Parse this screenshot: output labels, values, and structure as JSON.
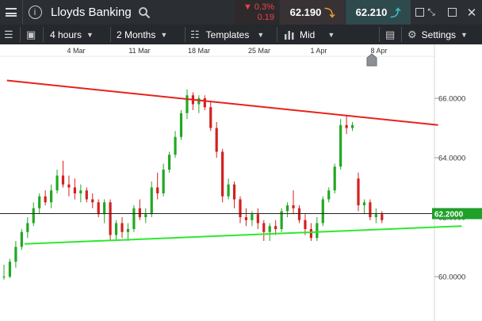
{
  "header": {
    "instrument_name": "Lloyds Banking",
    "change_percent": "0.3%",
    "change_abs": "0.19",
    "sell_price": "62.190",
    "buy_price": "62.210",
    "icons": [
      "menu-icon",
      "info-icon",
      "search-icon",
      "down-arrow-icon",
      "up-arrow-icon",
      "checkbox-icon",
      "shrink-icon",
      "popout-icon",
      "close-icon"
    ]
  },
  "toolbar": {
    "interval": "4 hours",
    "range": "2 Months",
    "templates_label": "Templates",
    "price_type": "Mid",
    "settings_label": "Settings",
    "icons": [
      "list-icon",
      "layout-icon",
      "templates-icon",
      "bar-chart-icon",
      "panel-icon",
      "gear-icon"
    ]
  },
  "colors": {
    "resistance_line": "#e8211c",
    "support_line": "#2ee82e",
    "up_candle": "#22a822",
    "down_candle": "#d42020",
    "price_label_bg": "#1fa02a"
  },
  "chart_data": {
    "type": "candlestick",
    "x_labels": [
      "4 Mar",
      "11 Mar",
      "18 Mar",
      "25 Mar",
      "1 Apr",
      "8 Apr"
    ],
    "y_ticks": [
      "66.0000",
      "64.0000",
      "62.0000",
      "60.0000"
    ],
    "y_range": [
      59.3,
      67.3
    ],
    "current_price_label": "62.2000",
    "current_price": 62.2,
    "trendlines": [
      {
        "name": "resistance",
        "from": {
          "x": 0.5,
          "y": 66.6
        },
        "to": {
          "x": 73.5,
          "y": 65.1
        }
      },
      {
        "name": "support",
        "from": {
          "x": 3.5,
          "y": 61.1
        },
        "to": {
          "x": 77.5,
          "y": 61.7
        }
      }
    ],
    "candles": [
      [
        60.0,
        60.4,
        59.9,
        60.0
      ],
      [
        60.0,
        60.6,
        59.95,
        60.5
      ],
      [
        60.5,
        61.2,
        60.3,
        61.0
      ],
      [
        61.0,
        61.6,
        60.9,
        61.5
      ],
      [
        61.5,
        62.0,
        61.3,
        61.8
      ],
      [
        61.8,
        62.5,
        61.7,
        62.3
      ],
      [
        62.3,
        62.8,
        62.1,
        62.7
      ],
      [
        62.7,
        62.9,
        62.4,
        62.5
      ],
      [
        62.5,
        63.1,
        62.3,
        62.9
      ],
      [
        62.9,
        63.6,
        62.8,
        63.4
      ],
      [
        63.4,
        63.9,
        63.0,
        63.1
      ],
      [
        63.1,
        63.4,
        62.7,
        63.0
      ],
      [
        63.0,
        63.3,
        62.6,
        62.8
      ],
      [
        62.8,
        63.1,
        62.5,
        62.9
      ],
      [
        62.9,
        63.0,
        62.5,
        62.6
      ],
      [
        62.6,
        62.8,
        62.3,
        62.5
      ],
      [
        62.5,
        62.6,
        62.0,
        62.1
      ],
      [
        62.1,
        62.6,
        61.8,
        62.5
      ],
      [
        62.5,
        62.6,
        61.2,
        61.4
      ],
      [
        61.4,
        61.9,
        61.2,
        61.8
      ],
      [
        61.8,
        62.0,
        61.3,
        61.5
      ],
      [
        61.5,
        61.8,
        61.2,
        61.6
      ],
      [
        61.6,
        62.4,
        61.5,
        62.3
      ],
      [
        62.3,
        62.6,
        61.9,
        62.0
      ],
      [
        62.0,
        62.3,
        61.8,
        62.1
      ],
      [
        62.1,
        63.2,
        62.0,
        63.0
      ],
      [
        63.0,
        63.5,
        62.6,
        62.8
      ],
      [
        62.8,
        63.8,
        62.7,
        63.6
      ],
      [
        63.6,
        64.2,
        63.5,
        64.1
      ],
      [
        64.1,
        64.9,
        64.0,
        64.7
      ],
      [
        64.7,
        65.6,
        64.6,
        65.5
      ],
      [
        65.5,
        66.3,
        65.3,
        66.1
      ],
      [
        66.1,
        66.2,
        65.6,
        65.8
      ],
      [
        65.8,
        66.1,
        65.5,
        66.0
      ],
      [
        66.0,
        66.1,
        65.6,
        65.7
      ],
      [
        65.7,
        65.9,
        64.9,
        65.0
      ],
      [
        65.0,
        65.2,
        64.0,
        64.2
      ],
      [
        64.2,
        64.3,
        62.5,
        62.7
      ],
      [
        62.7,
        63.3,
        62.6,
        63.1
      ],
      [
        63.1,
        63.2,
        62.3,
        62.6
      ],
      [
        62.6,
        62.7,
        61.8,
        62.0
      ],
      [
        62.0,
        62.3,
        61.7,
        61.9
      ],
      [
        61.9,
        62.2,
        61.7,
        62.1
      ],
      [
        62.1,
        62.3,
        61.6,
        61.8
      ],
      [
        61.8,
        61.9,
        61.2,
        61.5
      ],
      [
        61.5,
        61.8,
        61.2,
        61.7
      ],
      [
        61.7,
        61.9,
        61.4,
        61.6
      ],
      [
        61.6,
        62.3,
        61.5,
        62.2
      ],
      [
        62.2,
        62.5,
        62.0,
        62.4
      ],
      [
        62.4,
        62.9,
        62.1,
        62.3
      ],
      [
        62.3,
        62.4,
        61.8,
        61.9
      ],
      [
        61.9,
        62.1,
        61.4,
        61.6
      ],
      [
        61.6,
        61.8,
        61.2,
        61.3
      ],
      [
        61.3,
        62.0,
        61.2,
        61.8
      ],
      [
        61.8,
        62.7,
        61.7,
        62.6
      ],
      [
        62.6,
        63.0,
        62.5,
        62.9
      ],
      [
        62.9,
        63.8,
        62.8,
        63.7
      ],
      [
        63.7,
        65.3,
        63.6,
        65.1
      ],
      [
        65.1,
        65.4,
        64.8,
        65.0
      ],
      [
        65.0,
        65.2,
        64.9,
        65.1
      ],
      [
        63.3,
        63.5,
        62.2,
        62.4
      ],
      [
        62.4,
        62.6,
        62.1,
        62.5
      ],
      [
        62.5,
        62.6,
        61.9,
        62.0
      ],
      [
        62.0,
        62.3,
        61.8,
        62.1
      ],
      [
        62.1,
        62.2,
        61.8,
        61.9
      ]
    ]
  }
}
